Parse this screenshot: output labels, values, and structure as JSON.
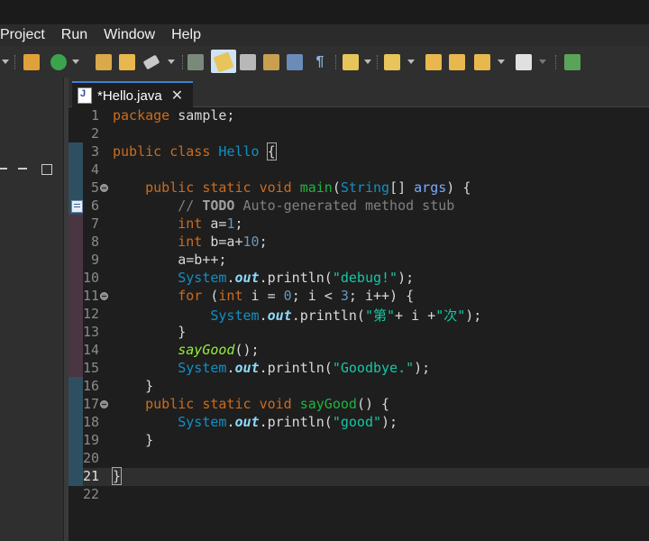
{
  "menu": [
    "Project",
    "Run",
    "Window",
    "Help"
  ],
  "toolbar": {
    "icons": [
      "dropdown-arrow-icon",
      "new-package-icon",
      "run-icon",
      "dropdown-arrow-icon",
      "open-type-icon",
      "open-folder-icon",
      "brush-icon",
      "dropdown-arrow-icon",
      "debug-icon",
      "mark-occurrences-icon",
      "toggle-block-icon",
      "word-wrap-icon",
      "breadcrumb-icon",
      "show-whitespace-icon",
      "next-annotation-icon",
      "previous-annotation-icon",
      "last-edit-location-icon",
      "back-icon",
      "forward-icon",
      "external-tools-icon"
    ],
    "active_icon": "mark-occurrences-icon"
  },
  "editor_tab": {
    "title": "*Hello.java",
    "file_icon_letter": "J",
    "close_glyph": "✕"
  },
  "editor": {
    "line_numbers": [
      "1",
      "2",
      "3",
      "4",
      "5",
      "6",
      "7",
      "8",
      "9",
      "10",
      "11",
      "12",
      "13",
      "14",
      "15",
      "16",
      "17",
      "18",
      "19",
      "20",
      "21",
      "22"
    ],
    "current_line": "21",
    "folding_lines": [
      "5",
      "11",
      "17"
    ],
    "task_marker_line": "6",
    "code": {
      "l1_kw": "package",
      "l1_rest": " sample;",
      "l3_kw1": "public",
      "l3_kw2": "class",
      "l3_name": "Hello",
      "l3_brace": "{",
      "l5_kw1": "public",
      "l5_kw2": "static",
      "l5_kw3": "void",
      "l5_method": "main",
      "l5_type": "String",
      "l5_arr": "[] ",
      "l5_param": "args",
      "l5_end": ") {",
      "l6_comment1": "// ",
      "l6_todo": "TODO",
      "l6_comment2": " Auto-generated method stub",
      "l7_type": "int",
      "l7_var": " a=",
      "l7_num": "1",
      "l7_end": ";",
      "l8_type": "int",
      "l8_var": " b=a+",
      "l8_num": "10",
      "l8_end": ";",
      "l9": "a=b++;",
      "l10_cls": "System",
      "l10_dot": ".",
      "l10_field": "out",
      "l10_call": ".println(",
      "l10_str": "\"debug!\"",
      "l10_end": ");",
      "l11_kw": "for",
      "l11_p1": " (",
      "l11_type": "int",
      "l11_p2": " i = ",
      "l11_n0": "0",
      "l11_p3": "; i < ",
      "l11_n3": "3",
      "l11_p4": "; i++) {",
      "l12_cls": "System",
      "l12_dot": ".",
      "l12_field": "out",
      "l12_call": ".println(",
      "l12_str1": "\"第\"",
      "l12_mid": "+ i +",
      "l12_str2": "\"次\"",
      "l12_end": ");",
      "l13": "}",
      "l14_call": "sayGood",
      "l14_end": "();",
      "l15_cls": "System",
      "l15_dot": ".",
      "l15_field": "out",
      "l15_call": ".println(",
      "l15_str": "\"Goodbye.\"",
      "l15_end": ");",
      "l16": "}",
      "l17_kw1": "public",
      "l17_kw2": "static",
      "l17_kw3": "void",
      "l17_method": "sayGood",
      "l17_end": "() {",
      "l18_cls": "System",
      "l18_dot": ".",
      "l18_field": "out",
      "l18_call": ".println(",
      "l18_str": "\"good\"",
      "l18_end": ");",
      "l19": "}",
      "l21": "}"
    }
  },
  "colors": {
    "keyword": "#cc6c1d",
    "type": "#1290c3",
    "method_decl": "#1eb540",
    "string": "#17c6a3",
    "comment": "#808080",
    "number": "#6897bb",
    "tab_accent": "#3f7fd6"
  }
}
